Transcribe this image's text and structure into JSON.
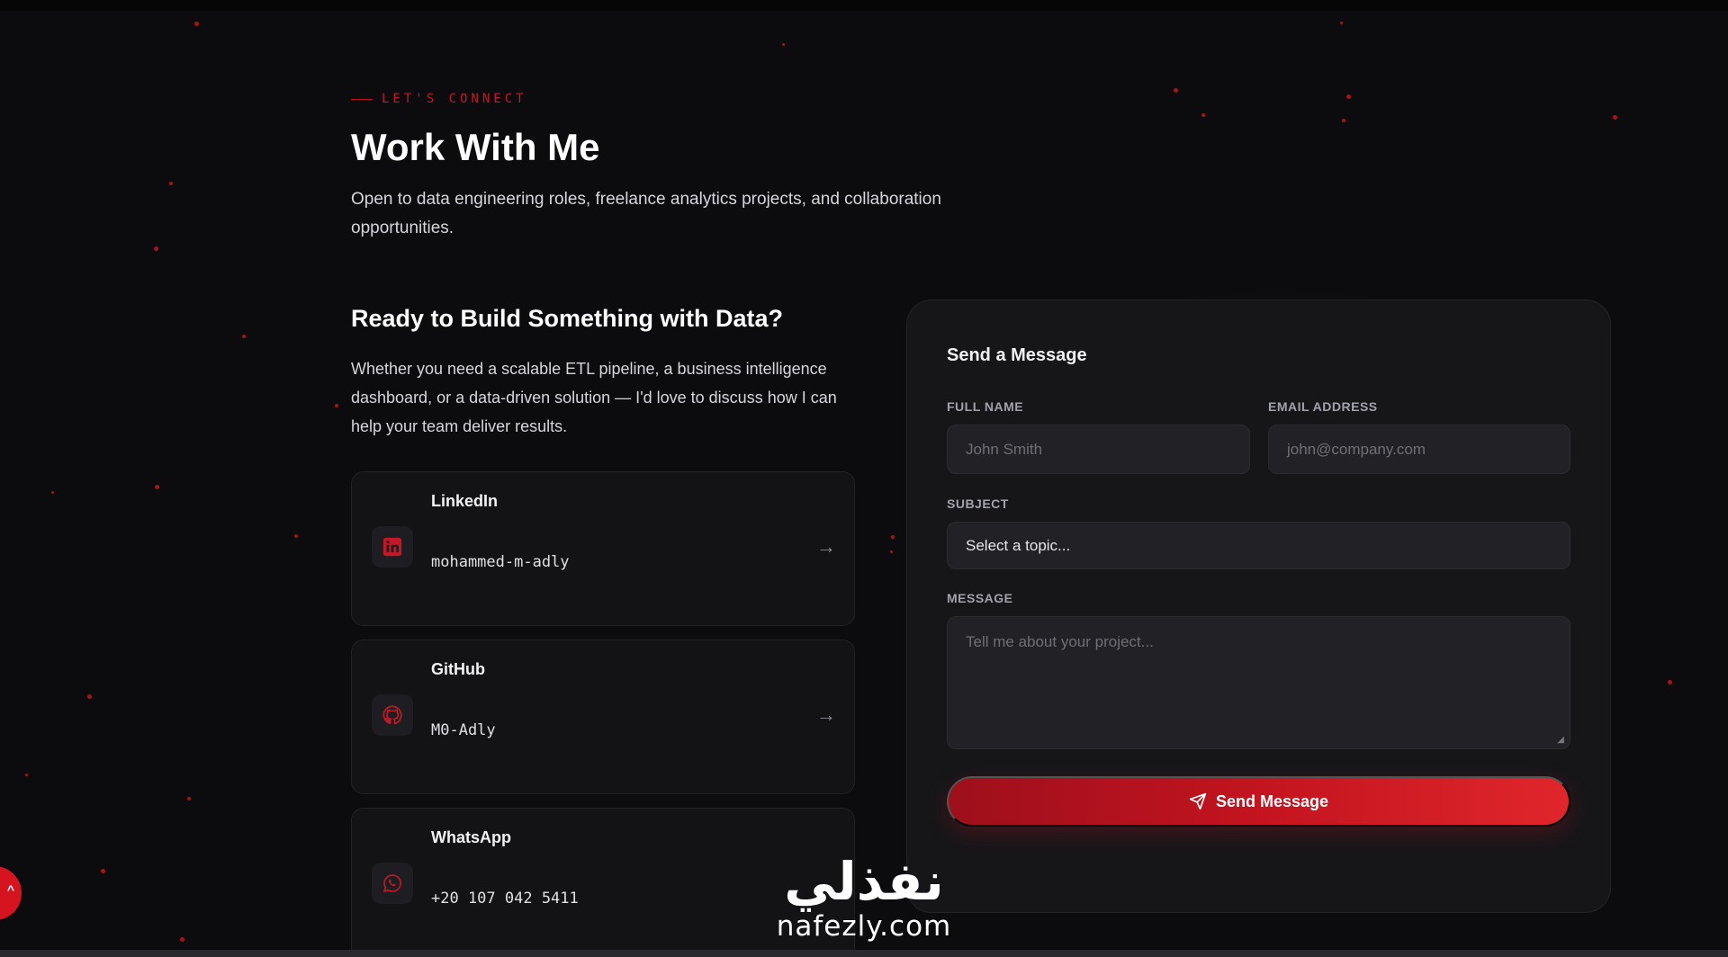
{
  "header": {
    "eyebrow": "LET'S CONNECT",
    "title": "Work With Me",
    "subtitle": "Open to data engineering roles, freelance analytics projects, and collaboration opportunities."
  },
  "intro": {
    "title": "Ready to Build Something with Data?",
    "text": "Whether you need a scalable ETL pipeline, a business intelligence dashboard, or a data-driven solution — I'd love to discuss how I can help your team deliver results."
  },
  "contacts": [
    {
      "label": "LinkedIn",
      "value": "mohammed-m-adly",
      "icon": "linkedin-icon"
    },
    {
      "label": "GitHub",
      "value": "M0-Adly",
      "icon": "github-icon"
    },
    {
      "label": "WhatsApp",
      "value": "+20 107 042 5411",
      "icon": "whatsapp-icon"
    }
  ],
  "arrow_glyph": "→",
  "form": {
    "title": "Send a Message",
    "full_name_label": "FULL NAME",
    "full_name_placeholder": "John Smith",
    "email_label": "EMAIL ADDRESS",
    "email_placeholder": "john@company.com",
    "subject_label": "SUBJECT",
    "subject_value": "Select a topic...",
    "message_label": "MESSAGE",
    "message_placeholder": "Tell me about your project...",
    "submit_label": "Send Message"
  },
  "watermark": {
    "arabic": "نفذلي",
    "latin": "nafezly.com"
  },
  "colors": {
    "accent": "#c3141f",
    "background": "#0c0c0e",
    "card": "#131316"
  }
}
